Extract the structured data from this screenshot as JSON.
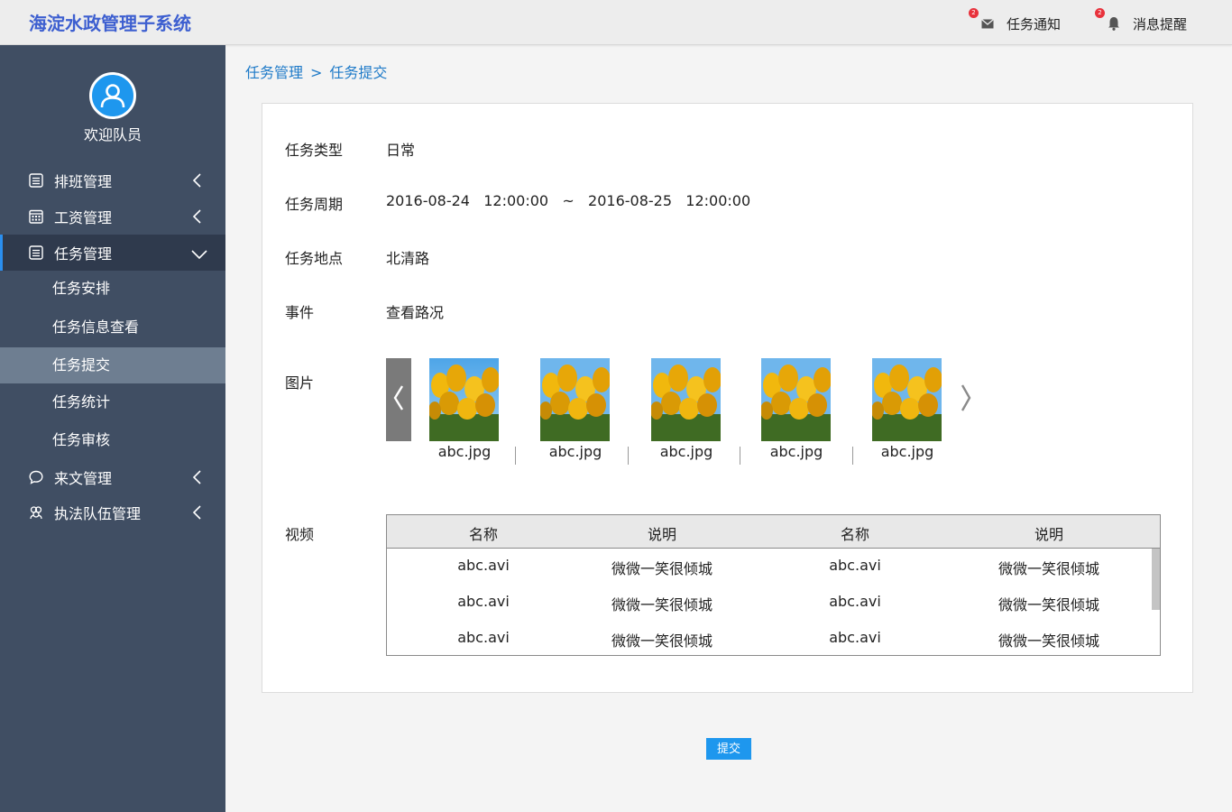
{
  "header": {
    "title": "海淀水政管理子系统",
    "notify": {
      "label": "任务通知",
      "badge": "2"
    },
    "remind": {
      "label": "消息提醒",
      "badge": "2"
    }
  },
  "sidebar": {
    "welcome": "欢迎队员",
    "items": [
      {
        "label": "排班管理",
        "icon": "list-icon"
      },
      {
        "label": "工资管理",
        "icon": "calendar-icon"
      },
      {
        "label": "任务管理",
        "icon": "list-icon",
        "expanded": true,
        "children": [
          "任务安排",
          "任务信息查看",
          "任务提交",
          "任务统计",
          "任务审核"
        ]
      },
      {
        "label": "来文管理",
        "icon": "chat-icon"
      },
      {
        "label": "执法队伍管理",
        "icon": "team-icon"
      }
    ],
    "active_child": "任务提交"
  },
  "breadcrumb": {
    "parent": "任务管理",
    "separator": ">",
    "current": "任务提交"
  },
  "form": {
    "type_label": "任务类型",
    "type_value": "日常",
    "period_label": "任务周期",
    "period_value": "2016-08-24   12:00:00   ~   2016-08-25   12:00:00",
    "place_label": "任务地点",
    "place_value": "北清路",
    "event_label": "事件",
    "event_value": "查看路况",
    "images_label": "图片",
    "images": [
      "abc.jpg",
      "abc.jpg",
      "abc.jpg",
      "abc.jpg",
      "abc.jpg"
    ],
    "video_label": "视频",
    "video_headers": [
      "名称",
      "说明",
      "名称",
      "说明"
    ],
    "video_rows": [
      [
        "abc.avi",
        "微微一笑很倾城",
        "abc.avi",
        "微微一笑很倾城"
      ],
      [
        "abc.avi",
        "微微一笑很倾城",
        "abc.avi",
        "微微一笑很倾城"
      ],
      [
        "abc.avi",
        "微微一笑很倾城",
        "abc.avi",
        "微微一笑很倾城"
      ]
    ]
  },
  "submit_label": "提交",
  "colors": {
    "sidebar": "#404e63",
    "accent": "#1e97ee",
    "title": "#3d5fd0",
    "link": "#1e7ac8"
  }
}
